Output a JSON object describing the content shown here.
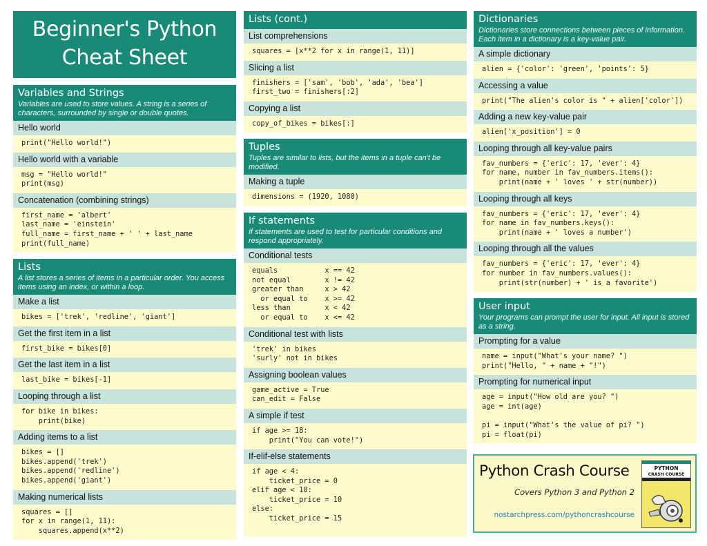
{
  "title": {
    "line1": "Beginner's Python",
    "line2": "Cheat Sheet"
  },
  "colors": {
    "accent": "#1a8a78",
    "subheader": "#c8e2dc",
    "code_bg": "#fdfbcb",
    "link": "#2a7fb8"
  },
  "sections": {
    "variables": {
      "title": "Variables and Strings",
      "desc": "Variables are used to store values. A string is a series of characters, surrounded by single or double quotes.",
      "items": [
        {
          "label": "Hello world",
          "code": "print(\"Hello world!\")"
        },
        {
          "label": "Hello world with a variable",
          "code": "msg = \"Hello world!\"\nprint(msg)"
        },
        {
          "label": "Concatenation (combining strings)",
          "code": "first_name = 'albert'\nlast_name = 'einstein'\nfull_name = first_name + ' ' + last_name\nprint(full_name)"
        }
      ]
    },
    "lists": {
      "title": "Lists",
      "desc": "A list stores a series of items in a particular order. You access items using an index, or within a loop.",
      "items": [
        {
          "label": "Make a list",
          "code": "bikes = ['trek', 'redline', 'giant']"
        },
        {
          "label": "Get the first item in a list",
          "code": "first_bike = bikes[0]"
        },
        {
          "label": "Get the last item in a list",
          "code": "last_bike = bikes[-1]"
        },
        {
          "label": "Looping through a list",
          "code": "for bike in bikes:\n    print(bike)"
        },
        {
          "label": "Adding items to a list",
          "code": "bikes = []\nbikes.append('trek')\nbikes.append('redline')\nbikes.append('giant')"
        },
        {
          "label": "Making numerical lists",
          "code": "squares = []\nfor x in range(1, 11):\n    squares.append(x**2)"
        }
      ]
    },
    "lists_cont": {
      "title": "Lists (cont.)",
      "items": [
        {
          "label": "List comprehensions",
          "code": "squares = [x**2 for x in range(1, 11)]"
        },
        {
          "label": "Slicing a list",
          "code": "finishers = ['sam', 'bob', 'ada', 'bea']\nfirst_two = finishers[:2]"
        },
        {
          "label": "Copying a list",
          "code": "copy_of_bikes = bikes[:]"
        }
      ]
    },
    "tuples": {
      "title": "Tuples",
      "desc": "Tuples are similar to lists, but the items in a tuple can't be modified.",
      "items": [
        {
          "label": "Making a tuple",
          "code": "dimensions = (1920, 1080)"
        }
      ]
    },
    "if_statements": {
      "title": "If statements",
      "desc": "If statements are used to test for particular conditions and respond appropriately.",
      "items": [
        {
          "label": "Conditional tests",
          "code": "equals           x == 42\nnot equal        x != 42\ngreater than     x > 42\n  or equal to    x >= 42\nless than        x < 42\n  or equal to    x <= 42"
        },
        {
          "label": "Conditional test with lists",
          "code": "'trek' in bikes\n'surly' not in bikes"
        },
        {
          "label": "Assigning boolean values",
          "code": "game_active = True\ncan_edit = False"
        },
        {
          "label": "A simple if test",
          "code": "if age >= 18:\n    print(\"You can vote!\")"
        },
        {
          "label": "If-elif-else statements",
          "code": "if age < 4:\n    ticket_price = 0\nelif age < 18:\n    ticket_price = 10\nelse:\n    ticket_price = 15"
        }
      ]
    },
    "dictionaries": {
      "title": "Dictionaries",
      "desc": "Dictionaries store connections between pieces of information. Each item in a dictionary is a key-value pair.",
      "items": [
        {
          "label": "A simple dictionary",
          "code": "alien = {'color': 'green', 'points': 5}"
        },
        {
          "label": "Accessing a value",
          "code": "print(\"The alien's color is \" + alien['color'])"
        },
        {
          "label": "Adding a new key-value pair",
          "code": "alien['x_position'] = 0"
        },
        {
          "label": "Looping through all key-value pairs",
          "code": "fav_numbers = {'eric': 17, 'ever': 4}\nfor name, number in fav_numbers.items():\n    print(name + ' loves ' + str(number))"
        },
        {
          "label": "Looping through all keys",
          "code": "fav_numbers = {'eric': 17, 'ever': 4}\nfor name in fav_numbers.keys():\n    print(name + ' loves a number')"
        },
        {
          "label": "Looping through all the values",
          "code": "fav_numbers = {'eric': 17, 'ever': 4}\nfor number in fav_numbers.values():\n    print(str(number) + ' is a favorite')"
        }
      ]
    },
    "user_input": {
      "title": "User input",
      "desc": "Your programs can prompt the user for input. All input is stored as a string.",
      "items": [
        {
          "label": "Prompting for a value",
          "code": "name = input(\"What's your name? \")\nprint(\"Hello, \" + name + \"!\")"
        },
        {
          "label": "Prompting for numerical input",
          "code": "age = input(\"How old are you? \")\nage = int(age)\n\npi = input(\"What's the value of pi? \")\npi = float(pi)"
        }
      ]
    }
  },
  "promo": {
    "title": "Python Crash Course",
    "subtitle": "Covers Python 3 and Python 2",
    "link": "nostarchpress.com/pythoncrashcourse",
    "book_title_1": "PYTHON",
    "book_title_2": "CRASH COURSE"
  }
}
